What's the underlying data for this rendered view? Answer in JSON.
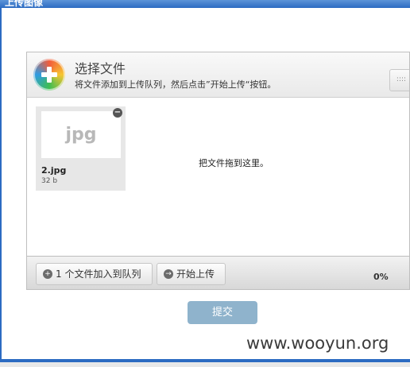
{
  "window": {
    "title": "上传图像"
  },
  "uploader": {
    "title": "选择文件",
    "subtitle": "将文件添加到上传队列，然后点击”开始上传“按钮。",
    "list_toggle_icon": "list-view-icon",
    "drop_text": "把文件拖到这里。",
    "files": [
      {
        "thumb_label": "jpg",
        "name": "2.jpg",
        "size": "32 b"
      }
    ],
    "footer": {
      "add_label": "1 个文件加入到队列",
      "start_label": "开始上传",
      "progress": "0%"
    }
  },
  "form": {
    "submit_label": "提交"
  },
  "watermark": "www.wooyun.org",
  "colors": {
    "titlebar": "#2c6bc2",
    "submit": "#8fb3cc"
  }
}
